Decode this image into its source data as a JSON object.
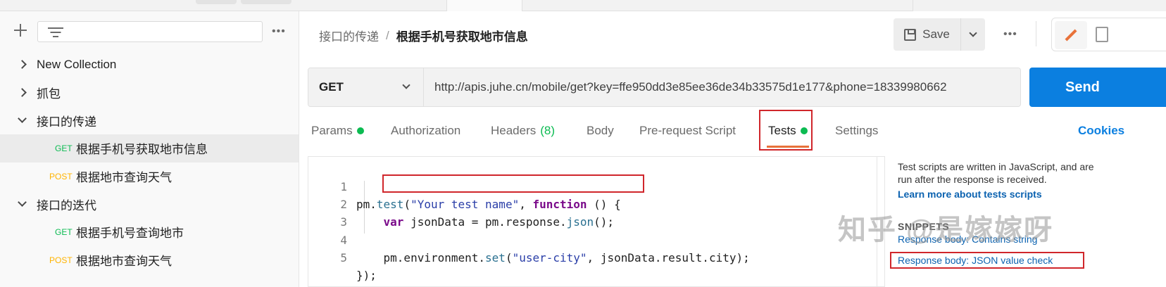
{
  "sidebar": {
    "more_label": "•••",
    "items": [
      {
        "type": "collection",
        "expanded": false,
        "label": "New Collection"
      },
      {
        "type": "collection",
        "expanded": false,
        "label": "抓包"
      },
      {
        "type": "collection",
        "expanded": true,
        "label": "接口的传递"
      },
      {
        "type": "request",
        "method": "GET",
        "label": "根据手机号获取地市信息",
        "selected": true
      },
      {
        "type": "request",
        "method": "POST",
        "label": "根据地市查询天气"
      },
      {
        "type": "collection",
        "expanded": true,
        "label": "接口的迭代"
      },
      {
        "type": "request",
        "method": "GET",
        "label": "根据手机号查询地市"
      },
      {
        "type": "request",
        "method": "POST",
        "label": "根据地市查询天气"
      }
    ]
  },
  "header": {
    "breadcrumb_parent": "接口的传递",
    "breadcrumb_sep": "/",
    "breadcrumb_current": "根据手机号获取地市信息",
    "save_label": "Save",
    "more_label": "•••"
  },
  "request": {
    "method": "GET",
    "url": "http://apis.juhe.cn/mobile/get?key=ffe950dd3e85ee36de34b33575d1e177&phone=18339980662",
    "send_label": "Send"
  },
  "tabs": {
    "params": "Params",
    "authorization": "Authorization",
    "headers": "Headers",
    "headers_count": "(8)",
    "body": "Body",
    "prerequest": "Pre-request Script",
    "tests": "Tests",
    "settings": "Settings",
    "cookies": "Cookies",
    "active": "tests"
  },
  "editor": {
    "lines": [
      {
        "num": "1",
        "text": "pm.test(\"Your test name\", function () {"
      },
      {
        "num": "2",
        "text": "    var jsonData = pm.response.json();"
      },
      {
        "num": "3",
        "text": ""
      },
      {
        "num": "4",
        "text": "    pm.environment.set(\"user-city\", jsonData.result.city);"
      },
      {
        "num": "5",
        "text": "});"
      }
    ]
  },
  "side_panel": {
    "description": "Test scripts are written in JavaScript, and are run after the response is received.",
    "learn_more": "Learn more about tests scripts",
    "snippets_header": "SNIPPETS",
    "snippet_partial": "Response body: Contains string",
    "snippet_json": "Response body: JSON value check"
  },
  "watermark": "知乎 @是嫁嫁呀",
  "colors": {
    "accent_orange": "#e8723a",
    "send_blue": "#0b7fe0",
    "get_green": "#0cbb52",
    "post_yellow": "#ffb400",
    "annotation_red": "#d0262b"
  }
}
